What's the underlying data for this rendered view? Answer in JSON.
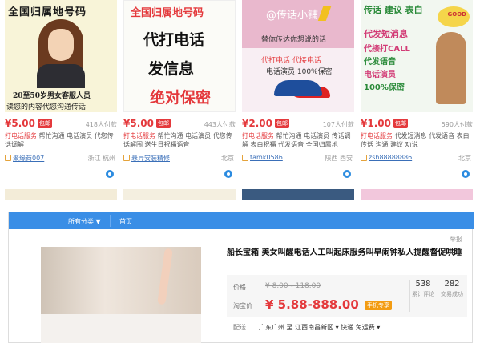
{
  "cards": [
    {
      "thumb": {
        "cap": "全国归属地号码",
        "cap2": "20至50岁男女客服人员",
        "cap3": "读您的内容代您沟通传话"
      },
      "price": "¥5.00",
      "badge": "包邮",
      "paid": "418人付款",
      "desc_hl": "打电话服务",
      "desc": " 帮忙沟通 电话演员 代您传话调解",
      "shop": "聚缘商007",
      "loc": "浙江 杭州"
    },
    {
      "thumb": {
        "l1": "全国归属地号码",
        "l2": "代打电话",
        "l3": "发信息",
        "l4": "绝对保密"
      },
      "price": "¥5.00",
      "badge": "包邮",
      "paid": "443人付款",
      "desc_hl": "打电话服务",
      "desc": " 帮忙沟通 电话演员 代您传话解围 送生日祝福语音",
      "shop": "悬异安装精修",
      "loc": "北京"
    },
    {
      "thumb": {
        "l1": "@传话小铺",
        "l2": "替你传达你想说的话",
        "tags": "代打电话    代接电话",
        "tags2": "电话演员    100%保密"
      },
      "price": "¥2.00",
      "badge": "包邮",
      "paid": "107人付款",
      "desc_hl": "打电话服务",
      "desc": " 帮忙沟通 电话演员 传话调解 表白祝福 代发语音 全国归属地",
      "shop": "tamk0586",
      "loc": "陕西 西安"
    },
    {
      "thumb": {
        "l1": "传话 建议 表白",
        "l2": "代发短消息",
        "l3": "代接打CALL",
        "l4": "代发语音",
        "l5": "电话演员",
        "l6": "100%保密",
        "l7": "GOOD"
      },
      "price": "¥1.00",
      "badge": "包邮",
      "paid": "590人付款",
      "desc_hl": "打电话服务",
      "desc": " 代发短消息 代发语音 表白 传话 沟通 建议 劝说",
      "shop": "zsh88888886",
      "loc": "北京"
    }
  ],
  "nav": {
    "all": "所有分类 ▼",
    "home": "首页"
  },
  "report": "举报",
  "product": {
    "title": "船长宝箱 美女叫醒电话人工叫起床服务叫早闹钟私人提醒督促哄睡",
    "price_label": "价格",
    "orig_price": "¥ 8.00 - 118.00",
    "promo_label": "淘宝价",
    "promo_price": "¥ 5.88-888.00",
    "promo_badge": "手机专享",
    "reviews_n": "538",
    "reviews_t": "累计评论",
    "sold_n": "282",
    "sold_t": "交易成功",
    "ship_label": "配送",
    "ship_value": "广东广州 至  江西南昌新区 ▾  快递 免运费 ▾"
  },
  "colors": {
    "accent": "#e4393c",
    "nav": "#3a8ee6"
  }
}
